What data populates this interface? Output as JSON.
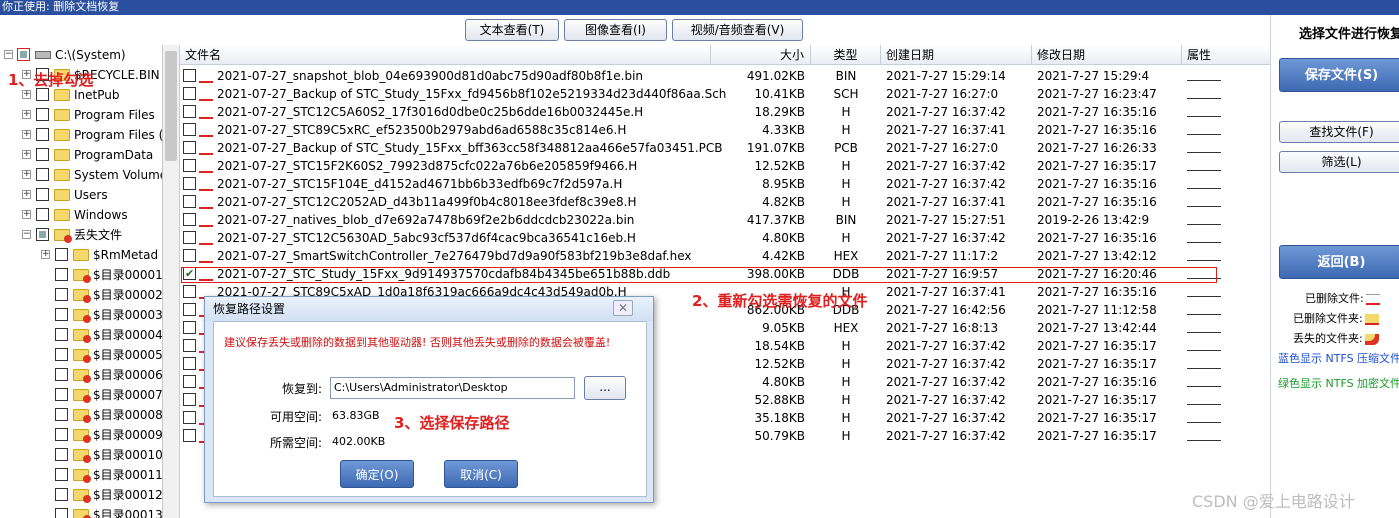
{
  "window": {
    "title": "你正使用: 删除文档恢复"
  },
  "viewbar": {
    "text_view": "文本查看(T)",
    "image_view": "图像查看(I)",
    "video_view": "视频/音频查看(V)"
  },
  "tree": {
    "root": "C:\\(System)",
    "items": [
      "$RECYCLE.BIN",
      "InetPub",
      "Program Files",
      "Program Files (",
      "ProgramData",
      "System Volume",
      "Users",
      "Windows",
      "丢失文件",
      "$RmMetad",
      "$目录00001",
      "$目录00002",
      "$目录00003",
      "$目录00004",
      "$目录00005",
      "$目录00006",
      "$目录00007",
      "$目录00008",
      "$目录00009",
      "$目录00010",
      "$目录00011",
      "$目录00012",
      "$目录00013"
    ]
  },
  "annotations": {
    "step1": "1、去掉勾选",
    "step2": "2、重新勾选需恢复的文件",
    "step3": "3、选择保存路径"
  },
  "list": {
    "headers": {
      "name": "文件名",
      "size": "大小",
      "type": "类型",
      "created": "创建日期",
      "modified": "修改日期",
      "attr": "属性"
    },
    "rows": [
      {
        "name": "2021-07-27_snapshot_blob_04e693900d81d0abc75d90adf80b8f1e.bin",
        "size": "491.02KB",
        "type": "BIN",
        "created": "2021-7-27 15:29:14",
        "modified": "2021-7-27 15:29:4"
      },
      {
        "name": "2021-07-27_Backup of STC_Study_15Fxx_fd9456b8f102e5219334d23d440f86aa.Sch",
        "size": "10.41KB",
        "type": "SCH",
        "created": "2021-7-27 16:27:0",
        "modified": "2021-7-27 16:23:47"
      },
      {
        "name": "2021-07-27_STC12C5A60S2_17f3016d0dbe0c25b6dde16b0032445e.H",
        "size": "18.29KB",
        "type": "H",
        "created": "2021-7-27 16:37:42",
        "modified": "2021-7-27 16:35:16"
      },
      {
        "name": "2021-07-27_STC89C5xRC_ef523500b2979abd6ad6588c35c814e6.H",
        "size": "4.33KB",
        "type": "H",
        "created": "2021-7-27 16:37:41",
        "modified": "2021-7-27 16:35:16"
      },
      {
        "name": "2021-07-27_Backup of STC_Study_15Fxx_bff363cc58f348812aa466e57fa03451.PCB",
        "size": "191.07KB",
        "type": "PCB",
        "created": "2021-7-27 16:27:0",
        "modified": "2021-7-27 16:26:33"
      },
      {
        "name": "2021-07-27_STC15F2K60S2_79923d875cfc022a76b6e205859f9466.H",
        "size": "12.52KB",
        "type": "H",
        "created": "2021-7-27 16:37:42",
        "modified": "2021-7-27 16:35:17"
      },
      {
        "name": "2021-07-27_STC15F104E_d4152ad4671bb6b33edfb69c7f2d597a.H",
        "size": "8.95KB",
        "type": "H",
        "created": "2021-7-27 16:37:42",
        "modified": "2021-7-27 16:35:16"
      },
      {
        "name": "2021-07-27_STC12C2052AD_d43b11a499f0b4c8018ee3fdef8c39e8.H",
        "size": "4.82KB",
        "type": "H",
        "created": "2021-7-27 16:37:41",
        "modified": "2021-7-27 16:35:16"
      },
      {
        "name": "2021-07-27_natives_blob_d7e692a7478b69f2e2b6ddcdcb23022a.bin",
        "size": "417.37KB",
        "type": "BIN",
        "created": "2021-7-27 15:27:51",
        "modified": "2019-2-26 13:42:9"
      },
      {
        "name": "2021-07-27_STC12C5630AD_5abc93cf537d6f4cac9bca36541c16eb.H",
        "size": "4.80KB",
        "type": "H",
        "created": "2021-7-27 16:37:42",
        "modified": "2021-7-27 16:35:16"
      },
      {
        "name": "2021-07-27_SmartSwitchController_7e276479bd7d9a90f583bf219b3e8daf.hex",
        "size": "4.42KB",
        "type": "HEX",
        "created": "2021-7-27 11:17:2",
        "modified": "2021-7-27 13:42:12"
      },
      {
        "name": "2021-07-27_STC_Study_15Fxx_9d914937570cdafb84b4345be651b88b.ddb",
        "size": "398.00KB",
        "type": "DDB",
        "created": "2021-7-27 16:9:57",
        "modified": "2021-7-27 16:20:46",
        "checked": true
      },
      {
        "name": "2021-07-27_STC89C5xAD_1d0a18f6319ac666a9dc4c43d549ad0b.H",
        "size": "",
        "type": "H",
        "created": "2021-7-27 16:37:41",
        "modified": "2021-7-27 16:35:16"
      },
      {
        "name": "",
        "size": "862.00KB",
        "type": "DDB",
        "created": "2021-7-27 16:42:56",
        "modified": "2021-7-27 11:12:58"
      },
      {
        "name": "",
        "size": "9.05KB",
        "type": "HEX",
        "created": "2021-7-27 16:8:13",
        "modified": "2021-7-27 13:42:44"
      },
      {
        "name": "",
        "size": "18.54KB",
        "type": "H",
        "created": "2021-7-27 16:37:42",
        "modified": "2021-7-27 16:35:17"
      },
      {
        "name": "",
        "size": "12.52KB",
        "type": "H",
        "created": "2021-7-27 16:37:42",
        "modified": "2021-7-27 16:35:17"
      },
      {
        "name": "",
        "size": "4.80KB",
        "type": "H",
        "created": "2021-7-27 16:37:42",
        "modified": "2021-7-27 16:35:16"
      },
      {
        "name": "",
        "size": "52.88KB",
        "type": "H",
        "created": "2021-7-27 16:37:42",
        "modified": "2021-7-27 16:35:17"
      },
      {
        "name": "",
        "size": "35.18KB",
        "type": "H",
        "created": "2021-7-27 16:37:42",
        "modified": "2021-7-27 16:35:17"
      },
      {
        "name": "",
        "size": "50.79KB",
        "type": "H",
        "created": "2021-7-27 16:37:42",
        "modified": "2021-7-27 16:35:17"
      }
    ]
  },
  "right": {
    "title": "选择文件进行恢复",
    "save": "保存文件(S)",
    "find": "查找文件(F)",
    "filter": "筛选(L)",
    "back": "返回(B)",
    "legend_deleted_file": "已删除文件:",
    "legend_deleted_folder": "已删除文件夹:",
    "legend_lost_folder": "丢失的文件夹:",
    "legend_blue": "蓝色显示 NTFS 压缩文件",
    "legend_green": "绿色显示 NTFS 加密文件"
  },
  "dialog": {
    "title": "恢复路径设置",
    "warning": "建议保存丢失或删除的数据到其他驱动器! 否则其他丢失或删除的数据会被覆盖!",
    "restore_to_label": "恢复到:",
    "restore_to_value": "C:\\Users\\Administrator\\Desktop",
    "browse": "...",
    "free_label": "可用空间:",
    "free_value": "63.83GB",
    "need_label": "所需空间:",
    "need_value": "402.00KB",
    "ok": "确定(O)",
    "cancel": "取消(C)"
  },
  "watermark": "CSDN @爱上电路设计"
}
